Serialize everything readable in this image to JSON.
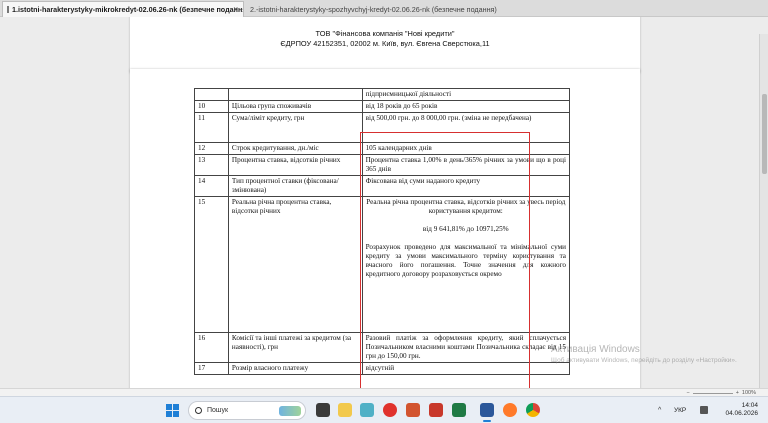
{
  "tabs": [
    {
      "label": "1.istotni-harakterystyky-mikrokredyt-02.06.26-nk (безпечне подання)",
      "close": "×"
    },
    {
      "label": "2.-istotni-harakterystyky-spozhyvchyj-kredyt-02.06.26-nk (безпечне подання)"
    }
  ],
  "letterhead": {
    "line1": "ТОВ \"Фінансова компанія \"Нові кредити\"",
    "line2": "ЄДРПОУ 42152351, 02002 м. Київ, вул. Євгена Сверстюка,11"
  },
  "table": {
    "top_value": "підприємницької діяльності",
    "rows": [
      {
        "num": "10",
        "name": "Цільова група споживачів",
        "value": "від 18 років до 65 років"
      },
      {
        "num": "11",
        "name": "Сума/ліміт кредиту, грн",
        "value": "від 500,00 грн. до 8 000,00 грн. (зміна не передбачена)"
      },
      {
        "num": "12",
        "name": "Строк кредитування, дн./міс",
        "value": "105 календарних днів"
      },
      {
        "num": "13",
        "name": "Процентна ставка, відсотків річних",
        "value": "Процентна ставка 1,00% в день/365% річних за умови що в році 365 днів"
      },
      {
        "num": "14",
        "name": "Тип процентної ставки (фіксована/змінювана)",
        "value": "Фіксована від суми наданого кредиту"
      },
      {
        "num": "15",
        "name": "Реальна річна процентна ставка, відсотки річних",
        "value_p1": "Реальна річна процентна ставка, відсотків річних за увесь період користування кредитом:",
        "value_p2": "від 9 641,81% до 10971,25%",
        "value_p3": "Розрахунок проведено для максимальної та мінімальної суми кредиту за умови максимального терміну користування та вчасного його погашення. Точне значення для кожного кредитного договору розраховується окремо"
      },
      {
        "num": "16",
        "name": "Комісії та інші платежі за кредитом (за наявності), грн",
        "value": "Разовий платіж за оформлення кредиту, який сплачується Позичальником власними коштами Позичальника складає від 15 грн до 150,00 грн."
      },
      {
        "num": "17",
        "name": "Розмір власного платежу",
        "value": "відсутній"
      }
    ]
  },
  "watermark": {
    "line1": "Активація Windows",
    "line2": "Щоб активувати Windows, перейдіть до розділу «Настройки»."
  },
  "statusbar": {
    "zoom": "100%"
  },
  "taskbar": {
    "search_placeholder": "Пошук",
    "lang": "УКР",
    "time": "14:04",
    "date": "04.06.2026",
    "caret": "^"
  },
  "colors": {
    "highlight_box": "#d63030",
    "start_accent": "#1f7fd6"
  }
}
